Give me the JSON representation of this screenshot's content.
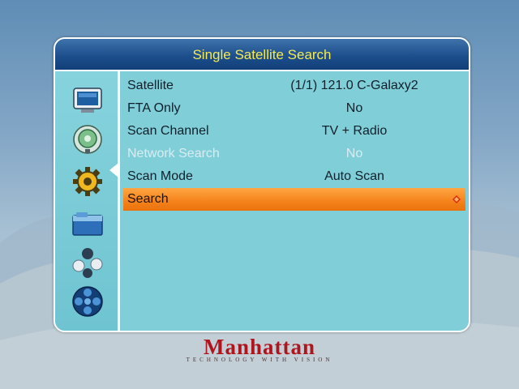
{
  "dialog": {
    "title": "Single Satellite Search"
  },
  "sidebar": {
    "icons": [
      "tv-icon",
      "satellite-dish-icon",
      "gear-icon",
      "folder-icon",
      "games-icon",
      "film-reel-icon"
    ],
    "active_index": 1
  },
  "menu": {
    "rows": [
      {
        "label": "Satellite",
        "value": "(1/1) 121.0 C-Galaxy2",
        "state": "normal"
      },
      {
        "label": "FTA Only",
        "value": "No",
        "state": "normal"
      },
      {
        "label": "Scan Channel",
        "value": "TV + Radio",
        "state": "normal"
      },
      {
        "label": "Network Search",
        "value": "No",
        "state": "disabled"
      },
      {
        "label": "Scan Mode",
        "value": "Auto Scan",
        "state": "normal"
      },
      {
        "label": "Search",
        "value": "",
        "state": "selected"
      }
    ]
  },
  "logo": {
    "brand": "Manhattan",
    "tagline": "TECHNOLOGY WITH VISION"
  },
  "colors": {
    "title_text": "#f5ea52",
    "title_bar": "#1d4f8d",
    "panel": "#80ced8",
    "highlight": "#f5821a",
    "brand": "#b0141c"
  }
}
